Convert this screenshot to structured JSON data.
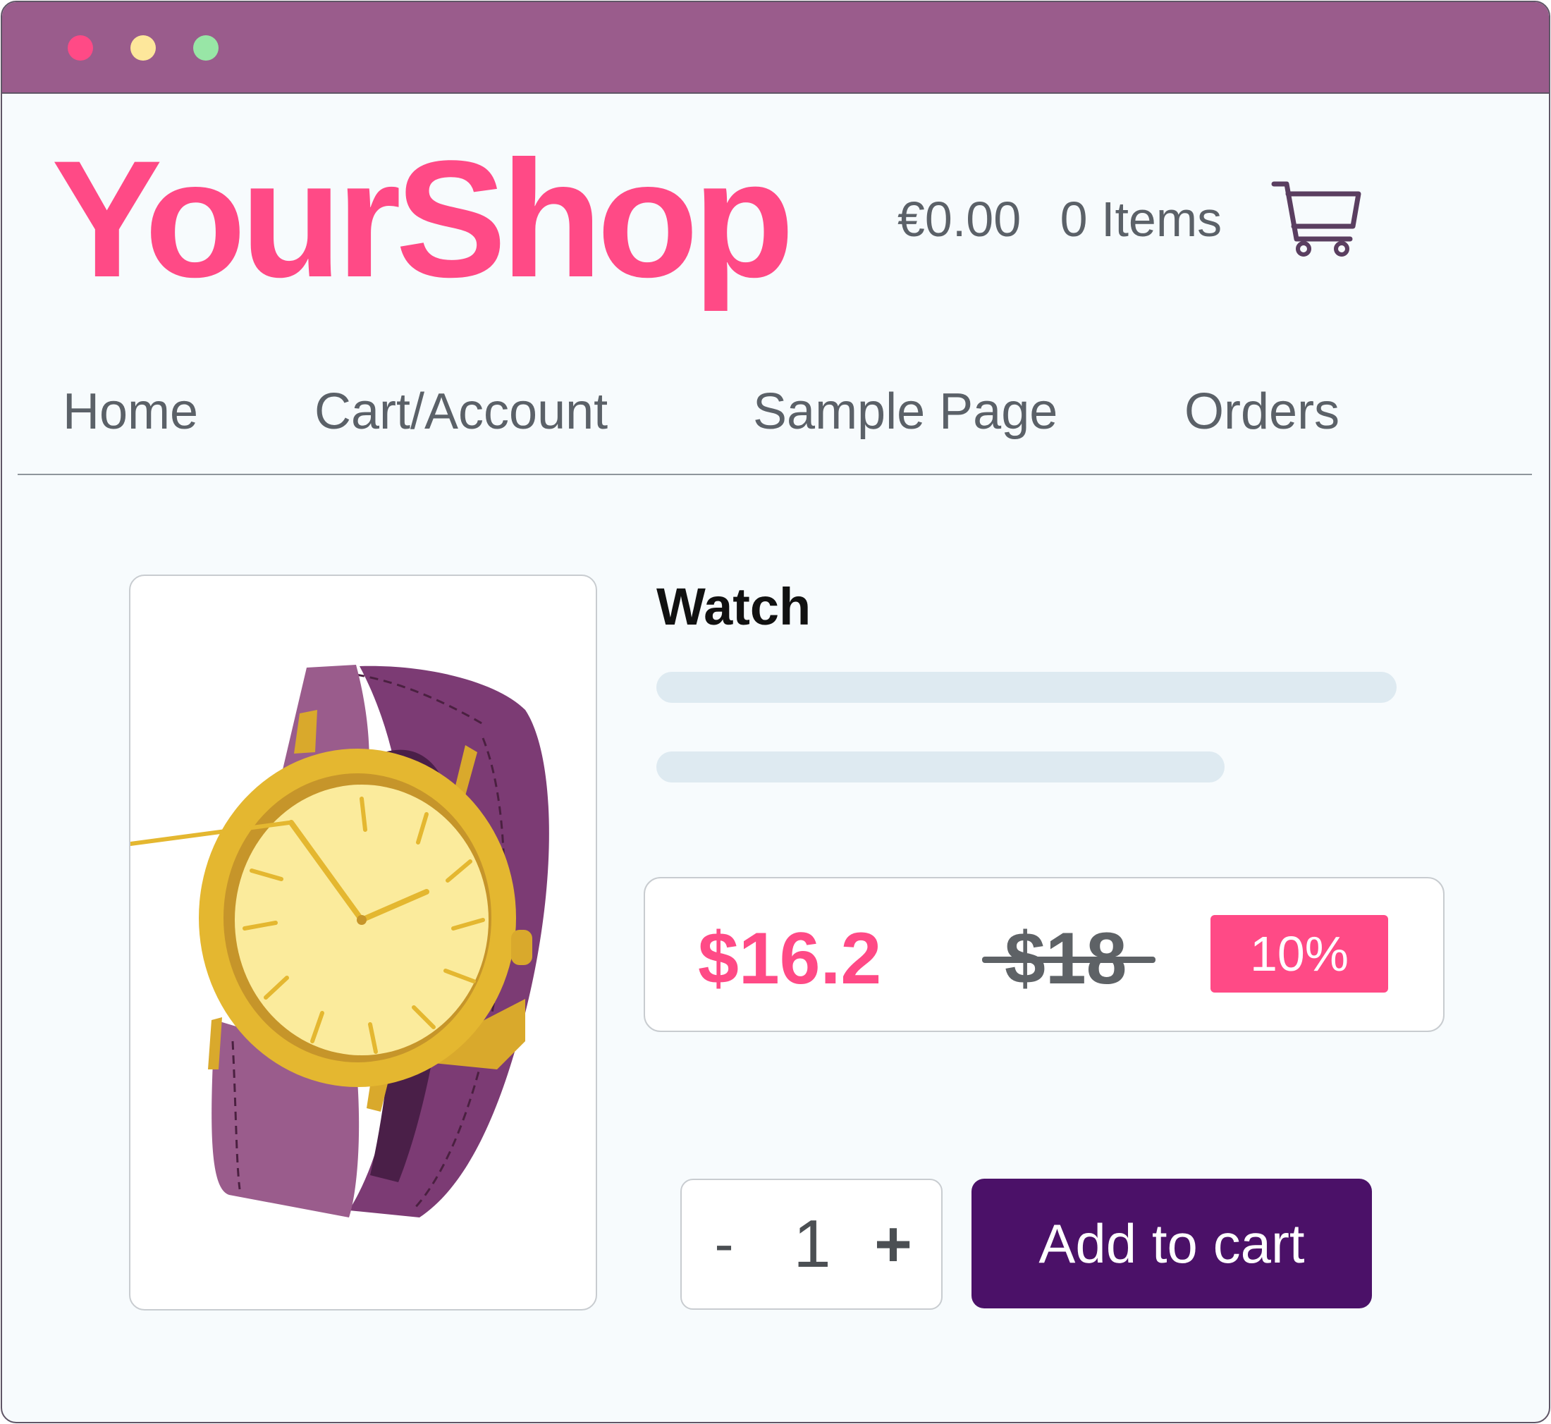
{
  "colors": {
    "titlebar": "#9a5c8c",
    "dot_red": "#ff4a86",
    "dot_yellow": "#fde79b",
    "dot_green": "#98e6a6",
    "brand": "#ff4a86",
    "cart_icon": "#5a3e60",
    "button": "#4b1168",
    "badge": "#ff4a86"
  },
  "header": {
    "logo": "YourShop",
    "cart_total": "€0.00",
    "cart_items": "0 Items",
    "cart_icon": "shopping-cart-icon"
  },
  "nav": {
    "items": [
      {
        "label": "Home"
      },
      {
        "label": "Cart/Account"
      },
      {
        "label": "Sample Page"
      },
      {
        "label": "Orders"
      }
    ]
  },
  "product": {
    "image_icon": "wristwatch-illustration",
    "title": "Watch",
    "price": "$16.2",
    "original_price": "$18",
    "discount": "10%",
    "quantity": {
      "minus_label": "-",
      "value": "1",
      "plus_label": "+"
    },
    "add_to_cart_label": "Add to cart"
  }
}
